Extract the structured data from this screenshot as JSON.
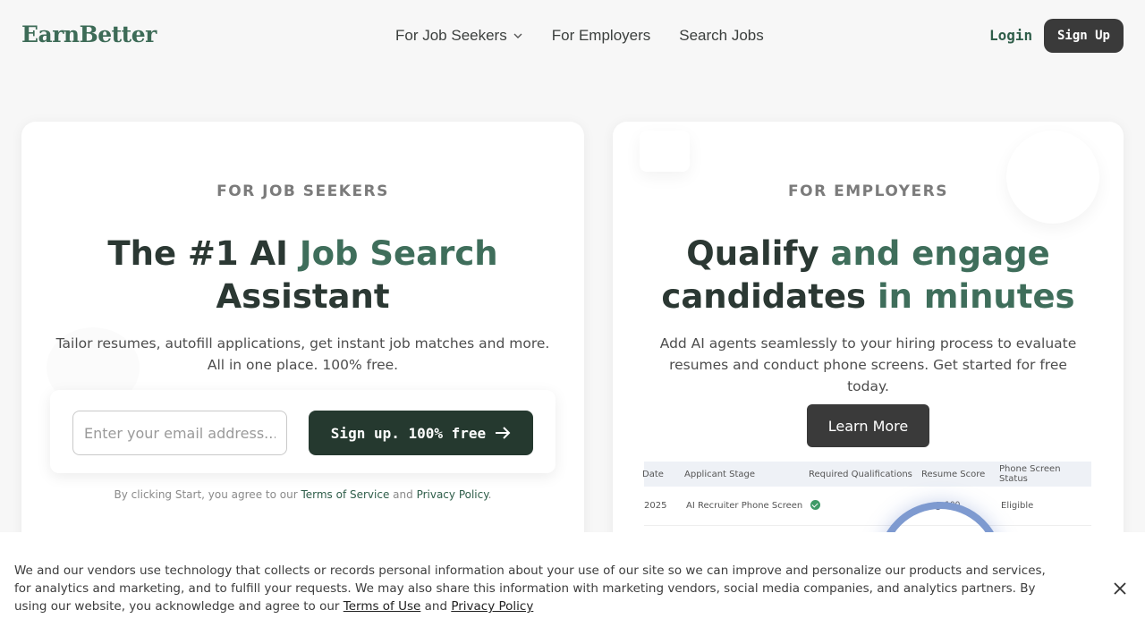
{
  "header": {
    "logo": "EarnBetter",
    "nav": [
      {
        "label": "For Job Seekers"
      },
      {
        "label": "For Employers"
      },
      {
        "label": "Search Jobs"
      }
    ],
    "login": "Login",
    "signup": "Sign Up"
  },
  "seekers": {
    "eyebrow": "FOR JOB SEEKERS",
    "title_a": "The #1 AI ",
    "title_b": "Job Search",
    "title_c": "Assistant",
    "subtitle": "Tailor resumes, autofill applications, get instant job matches and more. All in one place. 100% free.",
    "email_placeholder": "Enter your email address...",
    "cta": "Sign up. 100% free",
    "legal_prefix": "By clicking Start, you agree to our ",
    "terms": "Terms of Service",
    "legal_and": " and ",
    "privacy": "Privacy Policy",
    "legal_suffix": "."
  },
  "employers": {
    "eyebrow": "FOR EMPLOYERS",
    "title_a": "Qualify ",
    "title_b": "and engage",
    "title_c": "candidates ",
    "title_d": "in minutes",
    "subtitle": "Add AI agents seamlessly to your hiring process to evaluate resumes and conduct phone screens. Get started for free today.",
    "cta": "Learn More",
    "table": {
      "headers": [
        "Date",
        "Applicant Stage",
        "Required Qualifications",
        "Resume Score",
        "Phone Screen Status"
      ],
      "row": [
        "2025",
        "AI Recruiter Phone Screen",
        "",
        "100",
        "Eligible"
      ]
    }
  },
  "cookie": {
    "text": "We and our vendors use technology that collects or records personal information about your use of our site so we can improve and personalize our products and services, for analytics and marketing, and to fulfill your requests. We may also share this information with marketing vendors, social media companies, and analytics partners. By using our website, you acknowledge and agree to our ",
    "terms": "Terms of Use",
    "and": " and ",
    "privacy": "Privacy Policy"
  }
}
